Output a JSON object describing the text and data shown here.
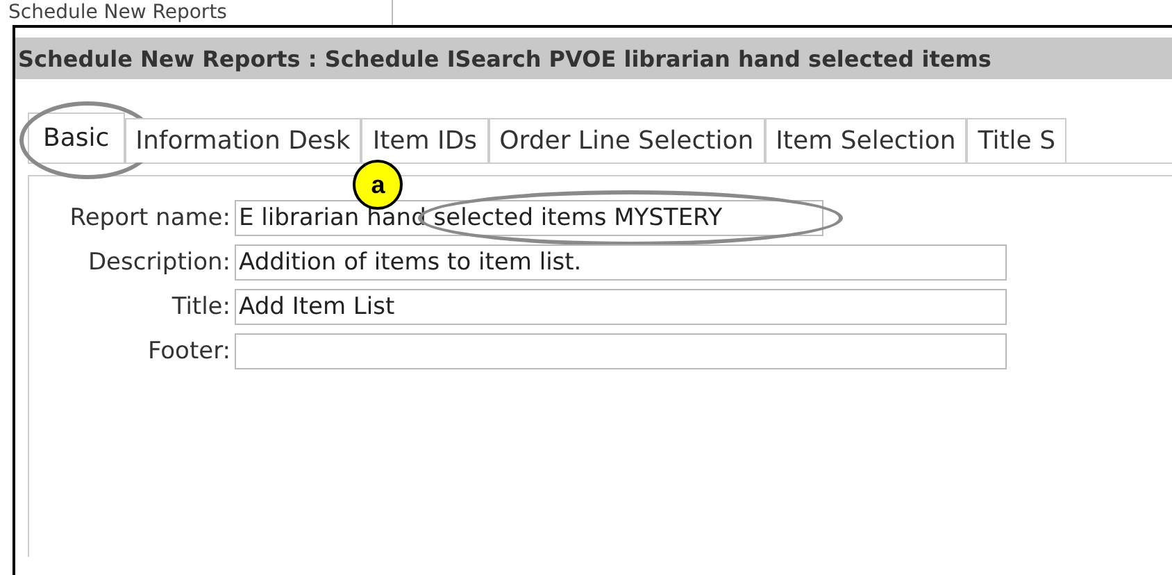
{
  "breadcrumb": "Schedule New Reports",
  "header": {
    "title": "Schedule New Reports : Schedule ISearch PVOE librarian hand selected items"
  },
  "tabs": [
    {
      "label": "Basic",
      "selected": true
    },
    {
      "label": "Information Desk",
      "selected": false
    },
    {
      "label": "Item IDs",
      "selected": false
    },
    {
      "label": "Order Line Selection",
      "selected": false
    },
    {
      "label": "Item Selection",
      "selected": false
    },
    {
      "label": "Title S",
      "selected": false
    }
  ],
  "fields": [
    {
      "label": "Report name:",
      "value": "E librarian hand selected items MYSTERY",
      "highlighted": true
    },
    {
      "label": "Description:",
      "value": "Addition of items to item list.",
      "highlighted": false
    },
    {
      "label": "Title:",
      "value": "Add Item List",
      "highlighted": false
    },
    {
      "label": "Footer:",
      "highlighted": false
    }
  ],
  "callout": {
    "label": "a"
  }
}
